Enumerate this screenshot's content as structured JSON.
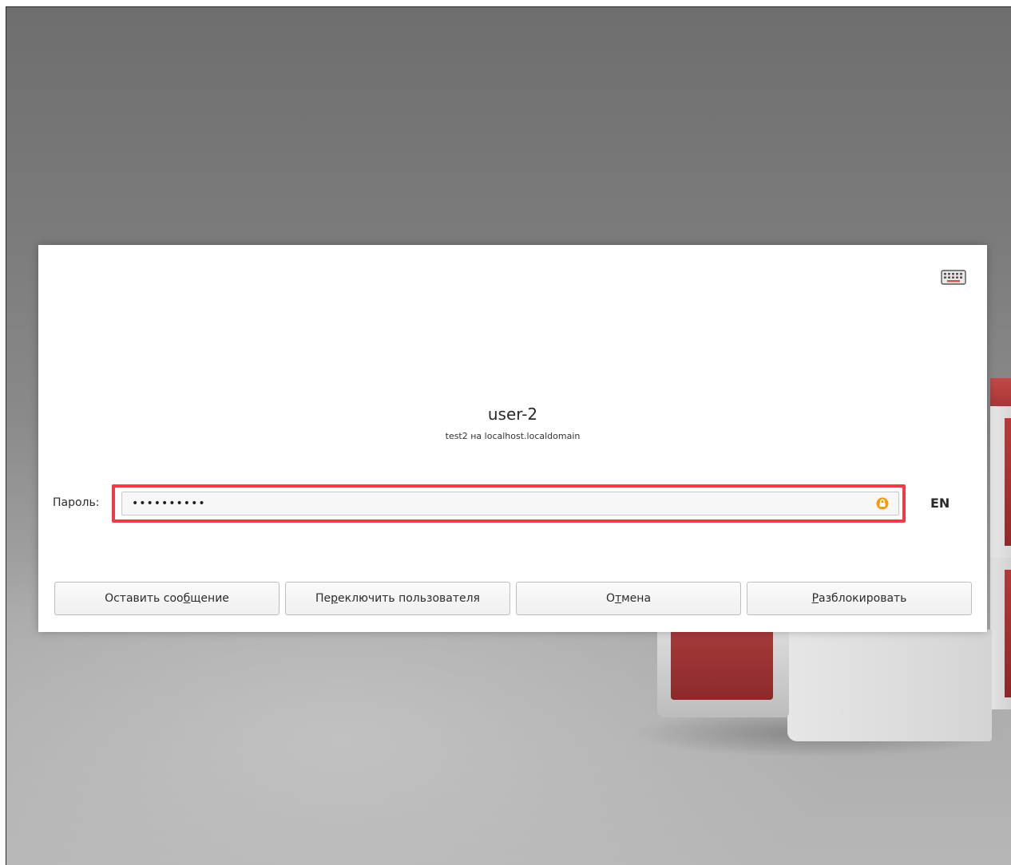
{
  "dialog": {
    "user_name": "user-2",
    "user_host": "test2 на localhost.localdomain",
    "password_label": "Пароль:",
    "password_value": "••••••••••",
    "layout_indicator": "EN",
    "keyboard_icon": "keyboard-icon",
    "caps_icon": "caps-lock-warning-icon"
  },
  "buttons": {
    "leave_message": {
      "before": "Оставить соо",
      "mnemonic": "б",
      "after": "щение"
    },
    "switch_user": {
      "before": "Пе",
      "mnemonic": "р",
      "after": "еключить пользователя"
    },
    "cancel": {
      "before": "О",
      "mnemonic": "т",
      "after": "мена"
    },
    "unlock": {
      "before": "",
      "mnemonic": "Р",
      "after": "азблокировать"
    }
  },
  "colors": {
    "highlight": "#ee3b44",
    "caps_icon": "#f39c12",
    "cube_red": "#a63a3a"
  }
}
